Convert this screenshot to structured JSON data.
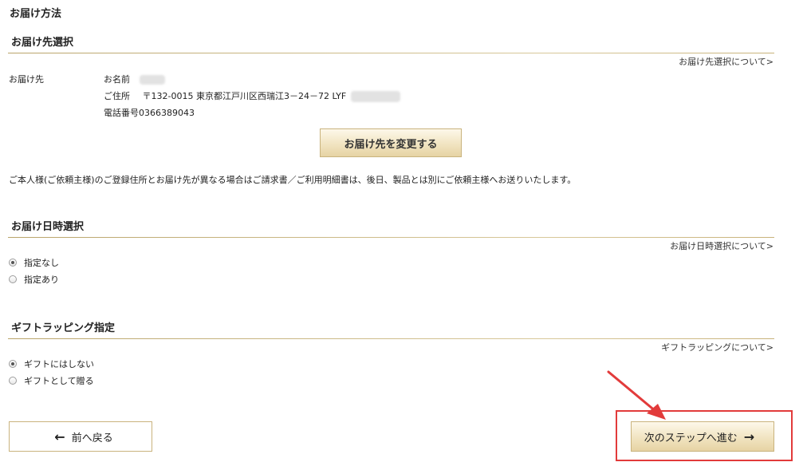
{
  "page": {
    "title": "お届け方法"
  },
  "destination": {
    "heading": "お届け先選択",
    "help_link": "お届け先選択について",
    "label": "お届け先",
    "name_label": "お名前",
    "address_label": "ご住所",
    "address_value": "〒132-0015 東京都江戸川区西瑞江3－24－72 LYF",
    "phone_label": "電話番号",
    "phone_value": "0366389043",
    "change_button": "お届け先を変更する",
    "note": "ご本人様(ご依頼主様)のご登録住所とお届け先が異なる場合はご請求書／ご利用明細書は、後日、製品とは別にご依頼主様へお送りいたします。"
  },
  "delivery_time": {
    "heading": "お届け日時選択",
    "help_link": "お届け日時選択について",
    "options": [
      {
        "label": "指定なし",
        "checked": true
      },
      {
        "label": "指定あり",
        "checked": false
      }
    ]
  },
  "gift": {
    "heading": "ギフトラッピング指定",
    "help_link": "ギフトラッピングについて",
    "options": [
      {
        "label": "ギフトにはしない",
        "checked": true
      },
      {
        "label": "ギフトとして贈る",
        "checked": false
      }
    ]
  },
  "nav": {
    "back_label": "前へ戻る",
    "next_label": "次のステップへ進む"
  },
  "icons": {
    "back": "arrow-left-icon",
    "next": "arrow-right-icon",
    "help": "chevron-right-icon"
  },
  "colors": {
    "rule": "#c8b27a",
    "highlight": "#e23b3b",
    "button_gold": "#f1e4c1"
  }
}
